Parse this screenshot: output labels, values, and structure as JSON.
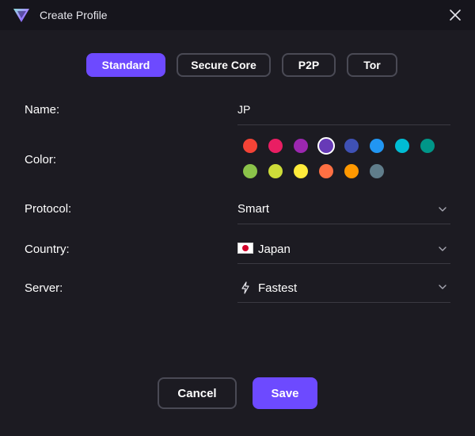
{
  "window": {
    "title": "Create Profile",
    "logo_icon": "proton-vpn-logo",
    "close_icon": "close-icon"
  },
  "tabs": [
    {
      "label": "Standard",
      "active": true
    },
    {
      "label": "Secure Core",
      "active": false
    },
    {
      "label": "P2P",
      "active": false
    },
    {
      "label": "Tor",
      "active": false
    }
  ],
  "form": {
    "name": {
      "label": "Name:",
      "value": "JP"
    },
    "color": {
      "label": "Color:",
      "selected": "#673ab7",
      "swatches": [
        "#f44336",
        "#e91e63",
        "#9c27b0",
        "#673ab7",
        "#3f51b5",
        "#2196f3",
        "#00bcd4",
        "#009688",
        "#8bc34a",
        "#cddc39",
        "#ffeb3b",
        "#ff7043",
        "#ff9800",
        "#607d8b"
      ]
    },
    "protocol": {
      "label": "Protocol:",
      "value": "Smart"
    },
    "country": {
      "label": "Country:",
      "value": "Japan",
      "flag_icon": "japan-flag-icon"
    },
    "server": {
      "label": "Server:",
      "value": "Fastest",
      "icon": "lightning-bolt-icon"
    }
  },
  "buttons": {
    "cancel": "Cancel",
    "save": "Save"
  },
  "colors": {
    "background": "#1c1b22",
    "titlebar": "#16151c",
    "accent": "#6d4aff",
    "border": "#4a4a55",
    "divider": "#3a3942"
  }
}
